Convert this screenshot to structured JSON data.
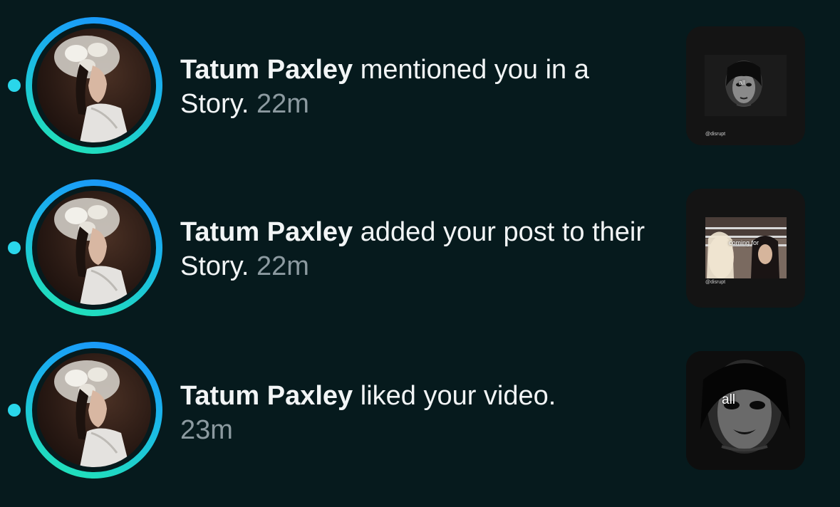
{
  "notifications": [
    {
      "name": "Tatum Paxley",
      "action": " mentioned you in a Story.",
      "time": "22m",
      "thumbnail": {
        "handle": "@disrupt",
        "overlay": "all"
      }
    },
    {
      "name": "Tatum Paxley",
      "action": " added your post to their Story.",
      "time": "22m",
      "thumbnail": {
        "handle": "@disrupt",
        "overlay": "coming for"
      }
    },
    {
      "name": "Tatum Paxley",
      "action": " liked your video.",
      "time": "23m",
      "thumbnail": {
        "overlay": "all"
      }
    }
  ],
  "colors": {
    "background": "#061a1d",
    "unread_dot": "#2ad6ea",
    "ring_start": "#1a8dff",
    "ring_end": "#22e8b0",
    "timestamp": "#8c9aa0"
  }
}
